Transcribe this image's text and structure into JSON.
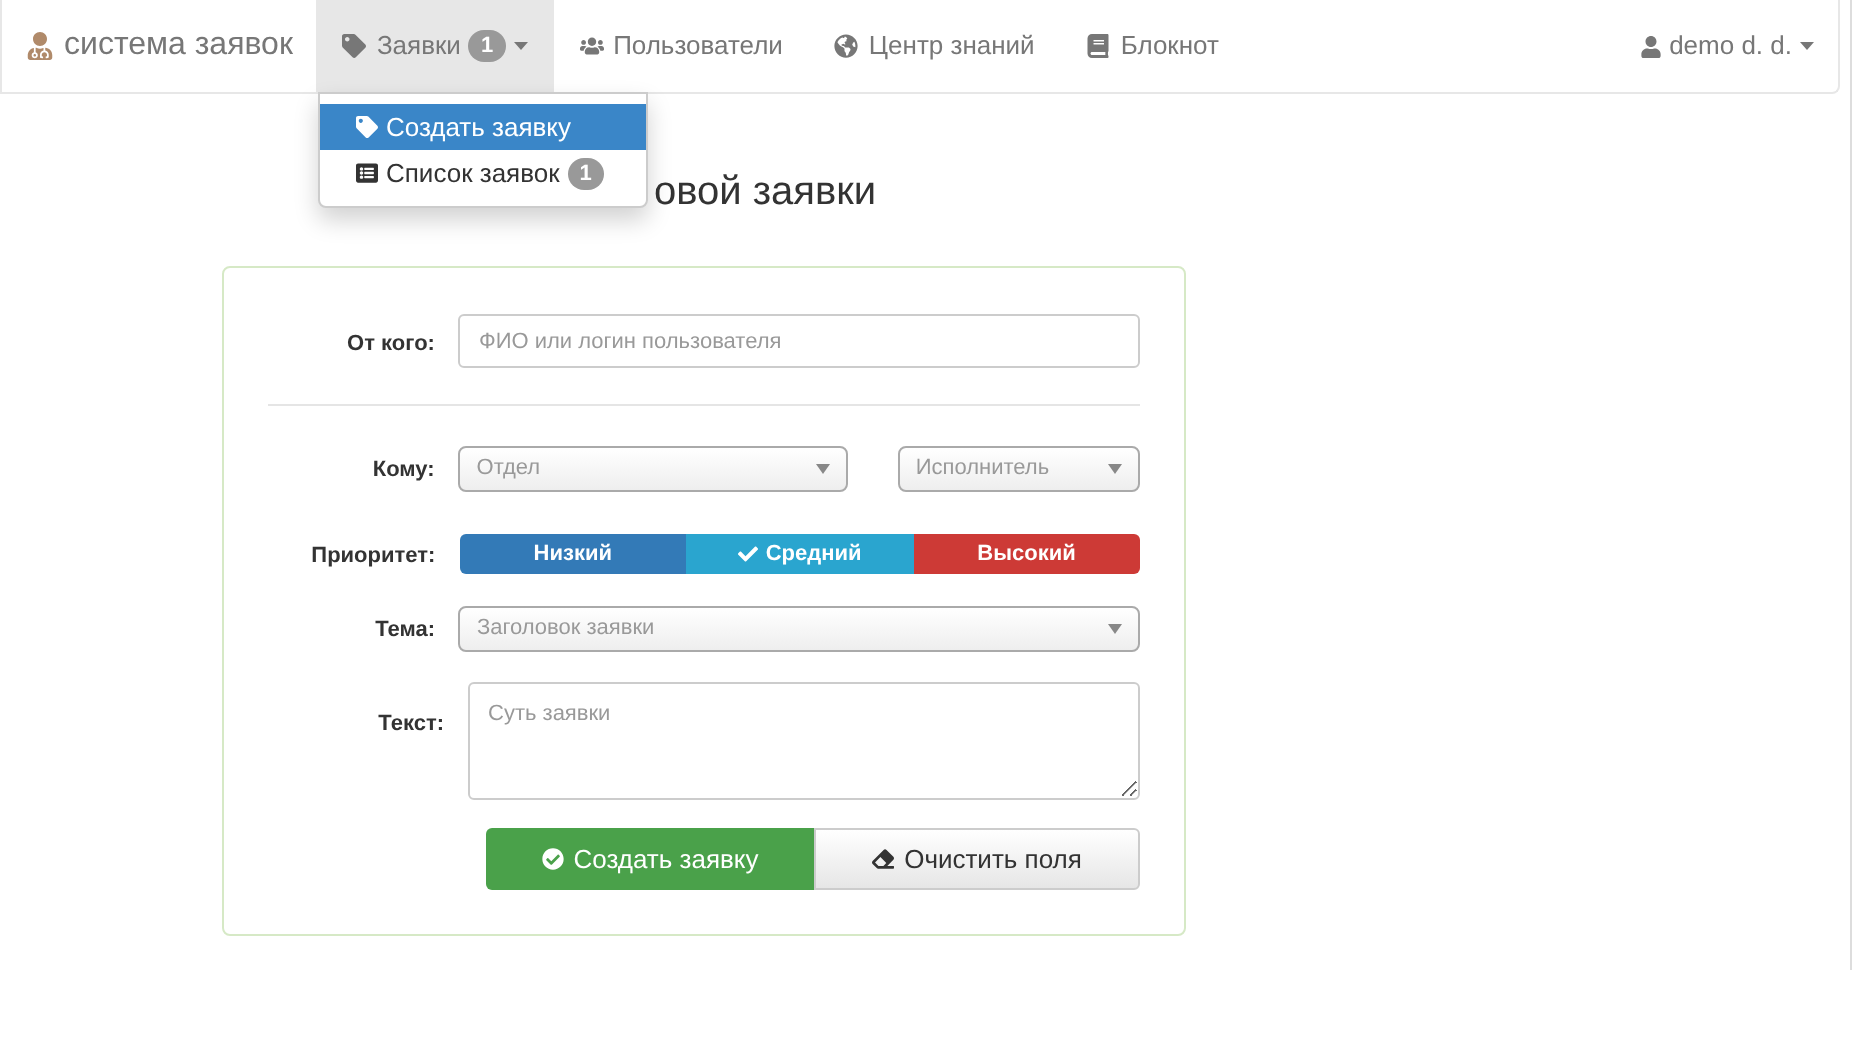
{
  "navbar": {
    "brand": "система заявок",
    "items": [
      {
        "label": "Заявки",
        "badge": "1",
        "selected": true,
        "dropdown": true
      },
      {
        "label": "Пользователи",
        "selected": false,
        "dropdown": false
      },
      {
        "label": "Центр знаний",
        "selected": false,
        "dropdown": false
      },
      {
        "label": "Блокнот",
        "selected": false,
        "dropdown": false
      }
    ],
    "user": "demo d. d."
  },
  "dropdown_menu": [
    {
      "label": "Создать заявку",
      "selected": true
    },
    {
      "label": "Список заявок",
      "badge": "1",
      "selected": false
    }
  ],
  "page_title": "овой заявки",
  "form": {
    "from": {
      "label": "От кого:",
      "placeholder": "ФИО или логин пользователя"
    },
    "to": {
      "label": "Кому:",
      "department": "Отдел",
      "executor": "Исполнитель"
    },
    "priority": {
      "label": "Приоритет:",
      "options": [
        {
          "label": "Низкий",
          "color": "#337ab7",
          "selected": false
        },
        {
          "label": "Средний",
          "color": "#2aa5cf",
          "selected": true
        },
        {
          "label": "Высокий",
          "color": "#cd3a36",
          "selected": false
        }
      ]
    },
    "subject": {
      "label": "Тема:",
      "placeholder": "Заголовок заявки"
    },
    "text": {
      "label": "Текст:",
      "placeholder": "Суть заявки"
    },
    "buttons": [
      {
        "label": "Создать заявку",
        "kind": "primary"
      },
      {
        "label": "Очистить поля",
        "kind": "default"
      }
    ]
  }
}
